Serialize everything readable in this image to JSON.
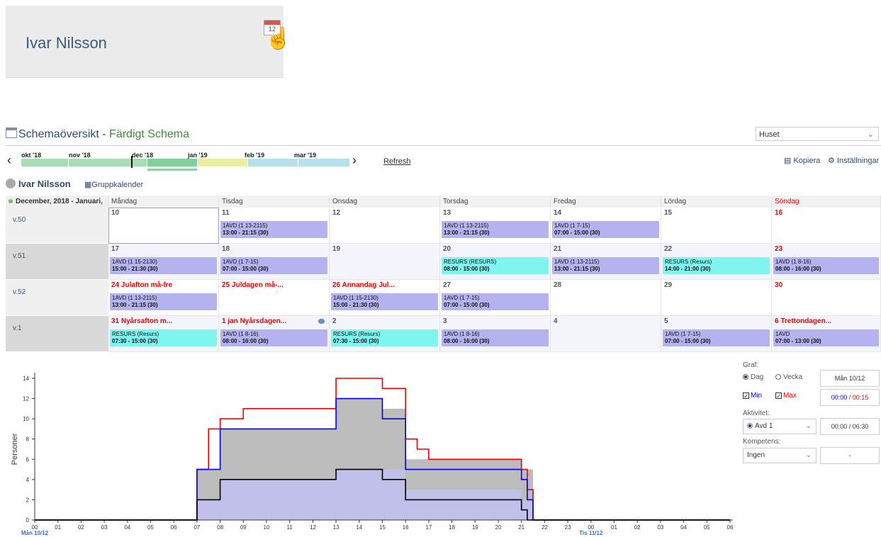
{
  "zoom": {
    "name": "Ivar Nilsson",
    "calendar_day": "12"
  },
  "header": {
    "title_main": "Schemaöversikt - ",
    "title_status": "Färdigt Schema",
    "unit_select": "Huset"
  },
  "timeline": {
    "months": [
      "okt '18",
      "nov '18",
      "dec '18",
      "jan '19",
      "feb '19",
      "mar '19"
    ],
    "refresh_label": "Refresh",
    "colors": {
      "past": "#a9dcb8",
      "current": "#7fcf98",
      "yellow": "#eaf0a0",
      "future": "#b7e1ea"
    }
  },
  "actions": {
    "copy_label": "Kopiera",
    "settings_label": "Inställningar"
  },
  "person": {
    "name": "Ivar Nilsson",
    "group_calendar_label": "Gruppkalender"
  },
  "calendar": {
    "range_label": "December, 2018 - Januari,",
    "weekdays": [
      "Måndag",
      "Tisdag",
      "Onsdag",
      "Torsdag",
      "Fredag",
      "Lördag",
      "Söndag"
    ],
    "weeks": [
      {
        "label": "v.50",
        "days": [
          {
            "num": "10",
            "red": false,
            "shift": null
          },
          {
            "num": "11",
            "red": false,
            "shift": {
              "kind": "avd",
              "name": "1AVD (1 13-2115)",
              "time": "13:00 - 21:15 (30)"
            }
          },
          {
            "num": "12",
            "red": false,
            "shift": null
          },
          {
            "num": "13",
            "red": false,
            "shift": {
              "kind": "avd",
              "name": "1AVD (1 13-2115)",
              "time": "13:00 - 21:15 (30)"
            }
          },
          {
            "num": "14",
            "red": false,
            "shift": {
              "kind": "avd",
              "name": "1AVD (1 7-15)",
              "time": "07:00 - 15:00 (30)"
            }
          },
          {
            "num": "15",
            "red": false,
            "shift": null
          },
          {
            "num": "16",
            "red": true,
            "shift": null
          }
        ]
      },
      {
        "label": "v.51",
        "days": [
          {
            "num": "17",
            "red": false,
            "shift": {
              "kind": "avd",
              "name": "1AVD (1 15-2130)",
              "time": "15:00 - 21:30 (30)"
            }
          },
          {
            "num": "18",
            "red": false,
            "shift": {
              "kind": "avd",
              "name": "1AVD (1 7-15)",
              "time": "07:00 - 15:00 (30)"
            }
          },
          {
            "num": "19",
            "red": false,
            "shift": null
          },
          {
            "num": "20",
            "red": false,
            "shift": {
              "kind": "res",
              "name": "RESURS (RESURS)",
              "time": "08:00 - 15:00 (30)"
            }
          },
          {
            "num": "21",
            "red": false,
            "shift": {
              "kind": "avd",
              "name": "1AVD (1 13-2115)",
              "time": "13:00 - 21:15 (30)"
            }
          },
          {
            "num": "22",
            "red": false,
            "shift": {
              "kind": "res",
              "name": "RESURS (Resurs)",
              "time": "14:00 - 21:00 (30)"
            }
          },
          {
            "num": "23",
            "red": true,
            "shift": {
              "kind": "avd",
              "name": "1AVD (1 8-16)",
              "time": "08:00 - 16:00 (30)"
            }
          }
        ]
      },
      {
        "label": "v.52",
        "days": [
          {
            "num": "24 Julafton må-fre",
            "red": true,
            "shift": {
              "kind": "avd",
              "name": "1AVD (1 13-2115)",
              "time": "13:00 - 21:15 (30)"
            }
          },
          {
            "num": "25 Juldagen må-...",
            "red": true,
            "shift": null
          },
          {
            "num": "26 Annandag Jul...",
            "red": true,
            "shift": {
              "kind": "avd",
              "name": "1AVD (1 15-2130)",
              "time": "15:00 - 21:30 (30)"
            }
          },
          {
            "num": "27",
            "red": false,
            "shift": {
              "kind": "avd",
              "name": "1AVD (1 7-15)",
              "time": "07:00 - 15:00 (30)"
            }
          },
          {
            "num": "28",
            "red": false,
            "shift": null
          },
          {
            "num": "29",
            "red": false,
            "shift": null
          },
          {
            "num": "30",
            "red": true,
            "shift": null
          }
        ]
      },
      {
        "label": "v.1",
        "days": [
          {
            "num": "31 Nyårsafton m...",
            "red": true,
            "shift": {
              "kind": "res",
              "name": "RESURS (Resurs)",
              "time": "07:30 - 15:00 (30)"
            }
          },
          {
            "num": "1 jan Nyårsdagen...",
            "red": true,
            "chat": true,
            "shift": {
              "kind": "avd",
              "name": "1AVD (1 8-16)",
              "time": "08:00 - 16:00 (30)"
            }
          },
          {
            "num": "2",
            "red": false,
            "shift": {
              "kind": "res",
              "name": "RESURS (Resurs)",
              "time": "07:30 - 15:00 (30)"
            }
          },
          {
            "num": "3",
            "red": false,
            "shift": {
              "kind": "avd",
              "name": "1AVD (1 8-16)",
              "time": "08:00 - 16:00 (30)"
            }
          },
          {
            "num": "4",
            "red": false,
            "shift": null
          },
          {
            "num": "5",
            "red": false,
            "shift": {
              "kind": "avd",
              "name": "1AVD (1 7-15)",
              "time": "07:00 - 15:00 (30)"
            }
          },
          {
            "num": "6 Trettondagen...",
            "red": true,
            "shift": {
              "kind": "avd",
              "name": "1AVD",
              "time": "07:00 - 13:00 (30)"
            }
          }
        ]
      }
    ]
  },
  "chart_data": {
    "type": "line",
    "ylabel": "Personer",
    "ylim": [
      0,
      14
    ],
    "yticks": [
      0,
      2,
      4,
      6,
      8,
      10,
      12,
      14
    ],
    "xticks": [
      "00",
      "01",
      "02",
      "03",
      "04",
      "05",
      "06",
      "07",
      "08",
      "09",
      "10",
      "11",
      "12",
      "13",
      "14",
      "15",
      "16",
      "17",
      "18",
      "19",
      "20",
      "21",
      "22",
      "23",
      "00",
      "01",
      "02",
      "03",
      "04",
      "05",
      "06"
    ],
    "xlabel_start": "Mån 10/12",
    "xlabel_mid": "Tis 11/12",
    "series": [
      {
        "color": "#ee0000",
        "style": "step",
        "points": [
          [
            0,
            0
          ],
          [
            7,
            0
          ],
          [
            7,
            5
          ],
          [
            7.5,
            5
          ],
          [
            7.5,
            9
          ],
          [
            8,
            9
          ],
          [
            8,
            10
          ],
          [
            9,
            10
          ],
          [
            9,
            11
          ],
          [
            13,
            11
          ],
          [
            13,
            14
          ],
          [
            15,
            14
          ],
          [
            15,
            13
          ],
          [
            16,
            13
          ],
          [
            16,
            8
          ],
          [
            16.5,
            8
          ],
          [
            16.5,
            7
          ],
          [
            17,
            7
          ],
          [
            17,
            6
          ],
          [
            21,
            6
          ],
          [
            21,
            5
          ],
          [
            21.25,
            5
          ],
          [
            21.25,
            3
          ],
          [
            21.5,
            3
          ],
          [
            21.5,
            0
          ],
          [
            30,
            0
          ]
        ]
      },
      {
        "color": "#0000ee",
        "style": "step",
        "points": [
          [
            0,
            0
          ],
          [
            7,
            0
          ],
          [
            7,
            5
          ],
          [
            8,
            5
          ],
          [
            8,
            9
          ],
          [
            13,
            9
          ],
          [
            13,
            12
          ],
          [
            15,
            12
          ],
          [
            15,
            10
          ],
          [
            16,
            10
          ],
          [
            16,
            5
          ],
          [
            21,
            5
          ],
          [
            21,
            4
          ],
          [
            21.25,
            4
          ],
          [
            21.25,
            2
          ],
          [
            21.5,
            2
          ],
          [
            21.5,
            0
          ],
          [
            30,
            0
          ]
        ]
      },
      {
        "color": "#000000",
        "style": "step",
        "points": [
          [
            0,
            0
          ],
          [
            7,
            0
          ],
          [
            7,
            2
          ],
          [
            8,
            2
          ],
          [
            8,
            4
          ],
          [
            13,
            4
          ],
          [
            13,
            5
          ],
          [
            15,
            5
          ],
          [
            15,
            4
          ],
          [
            16,
            4
          ],
          [
            16,
            2
          ],
          [
            21,
            2
          ],
          [
            21,
            1
          ],
          [
            21.25,
            1
          ],
          [
            21.25,
            0
          ],
          [
            30,
            0
          ]
        ]
      },
      {
        "color": "#b0b0b0",
        "style": "area",
        "points": [
          [
            7,
            0
          ],
          [
            7,
            5
          ],
          [
            8,
            5
          ],
          [
            8,
            9
          ],
          [
            13,
            9
          ],
          [
            13,
            12
          ],
          [
            15,
            12
          ],
          [
            15,
            11
          ],
          [
            16,
            11
          ],
          [
            16,
            6
          ],
          [
            21,
            6
          ],
          [
            21,
            5
          ],
          [
            21.5,
            5
          ],
          [
            21.5,
            0
          ]
        ]
      },
      {
        "color": "#c0c0f0",
        "style": "area",
        "points": [
          [
            7,
            0
          ],
          [
            7,
            2
          ],
          [
            8,
            2
          ],
          [
            8,
            4
          ],
          [
            13,
            4
          ],
          [
            13,
            5
          ],
          [
            16,
            5
          ],
          [
            16,
            3
          ],
          [
            21,
            3
          ],
          [
            21,
            2
          ],
          [
            21.5,
            2
          ],
          [
            21.5,
            0
          ]
        ]
      }
    ]
  },
  "controls": {
    "graf_label": "Graf:",
    "dag_label": "Dag",
    "vecka_label": "Vecka",
    "date_value": "Mån 10/12",
    "min_label": "Min",
    "max_label": "Max",
    "time_min": "00:00",
    "time_sep": " / ",
    "time_max": "00:15",
    "aktivitet_label": "Aktivitet:",
    "aktivitet_value": "Avd 1",
    "aktivitet_time": "00:00 / 06:30",
    "kompetens_label": "Kompetens:",
    "kompetens_value": "Ingen",
    "kompetens_extra": "-"
  }
}
